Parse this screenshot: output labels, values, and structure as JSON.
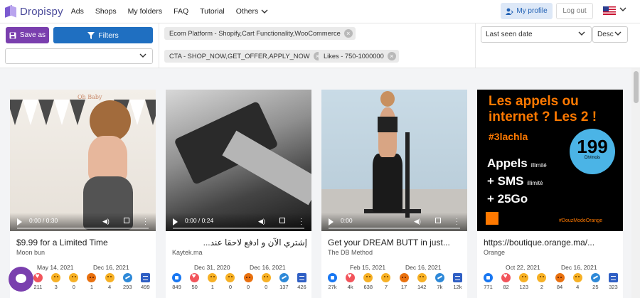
{
  "nav": {
    "brand": "Dropispy",
    "menu": [
      "Ads",
      "Shops",
      "My folders",
      "FAQ",
      "Tutorial",
      "Others"
    ],
    "profile": "My profile",
    "logout": "Log out",
    "flag_icon": "us-flag-icon"
  },
  "toolbar": {
    "save_label": "Save as",
    "filters_label": "Filters",
    "folder_select_value": ""
  },
  "chips": [
    "Ecom Platform - Shopify,Cart Functionality,WooCommerce",
    "CTA - SHOP_NOW,GET_OFFER,APPLY_NOW",
    "Likes - 750-1000000"
  ],
  "sort": {
    "field": "Last seen date",
    "order": "Desc"
  },
  "colors": {
    "accent_purple": "#7a3fae",
    "primary_blue": "#1f6fc1",
    "orange_brand": "#ff7900"
  },
  "cards": [
    {
      "title": "$9.99 for a Limited Time",
      "advertiser": "Moon bun",
      "first_seen": "May 14, 2021",
      "last_seen": "Dec 16, 2021",
      "video_time": "0:00 / 0:30",
      "image_text": "Oh Baby",
      "reactions": [
        {
          "icon": "love-icon",
          "count": "211"
        },
        {
          "icon": "haha-icon",
          "count": "3"
        },
        {
          "icon": "sad-icon",
          "count": "0"
        },
        {
          "icon": "angry-icon",
          "count": "1"
        },
        {
          "icon": "wow-icon",
          "count": "4"
        },
        {
          "icon": "share-icon",
          "count": "293"
        },
        {
          "icon": "comment-icon",
          "count": "499"
        }
      ]
    },
    {
      "title": "إشتري الآن و ادفع لاحقا عند...",
      "advertiser": "Kaytek.ma",
      "first_seen": "Dec 31, 2020",
      "last_seen": "Dec 16, 2021",
      "video_time": "0:00 / 0:24",
      "reactions": [
        {
          "icon": "like-icon",
          "count": "849"
        },
        {
          "icon": "love-icon",
          "count": "50"
        },
        {
          "icon": "haha-icon",
          "count": "1"
        },
        {
          "icon": "sad-icon",
          "count": "0"
        },
        {
          "icon": "angry-icon",
          "count": "0"
        },
        {
          "icon": "wow-icon",
          "count": "0"
        },
        {
          "icon": "share-icon",
          "count": "137"
        },
        {
          "icon": "comment-icon",
          "count": "426"
        }
      ]
    },
    {
      "title": "Get your DREAM BUTT in just...",
      "advertiser": "The DB Method",
      "first_seen": "Feb 15, 2021",
      "last_seen": "Dec 16, 2021",
      "video_time": "0:00",
      "reactions": [
        {
          "icon": "like-icon",
          "count": "27k"
        },
        {
          "icon": "love-icon",
          "count": "4k"
        },
        {
          "icon": "haha-icon",
          "count": "638"
        },
        {
          "icon": "sad-icon",
          "count": "7"
        },
        {
          "icon": "angry-icon",
          "count": "17"
        },
        {
          "icon": "wow-icon",
          "count": "142"
        },
        {
          "icon": "share-icon",
          "count": "7k"
        },
        {
          "icon": "comment-icon",
          "count": "12k"
        }
      ]
    },
    {
      "title": "https://boutique.orange.ma/...",
      "advertiser": "Orange",
      "first_seen": "Oct 22, 2021",
      "last_seen": "Dec 16, 2021",
      "image_text": {
        "line1": "Les appels ou",
        "line2": "internet ? Les 2 !",
        "hash": "#3lachla",
        "price": "199",
        "price_unit": "Dh/mois",
        "l1": "Appels",
        "l1s": "illimité",
        "l2": "+ SMS",
        "l2s": "illimité",
        "l3": "+ 25Go",
        "tag": "#DouzModeOrange"
      },
      "reactions": [
        {
          "icon": "like-icon",
          "count": "771"
        },
        {
          "icon": "love-icon",
          "count": "82"
        },
        {
          "icon": "haha-icon",
          "count": "123"
        },
        {
          "icon": "sad-icon",
          "count": "2"
        },
        {
          "icon": "angry-icon",
          "count": "84"
        },
        {
          "icon": "wow-icon",
          "count": "4"
        },
        {
          "icon": "share-icon",
          "count": "25"
        },
        {
          "icon": "comment-icon",
          "count": "323"
        }
      ]
    }
  ]
}
